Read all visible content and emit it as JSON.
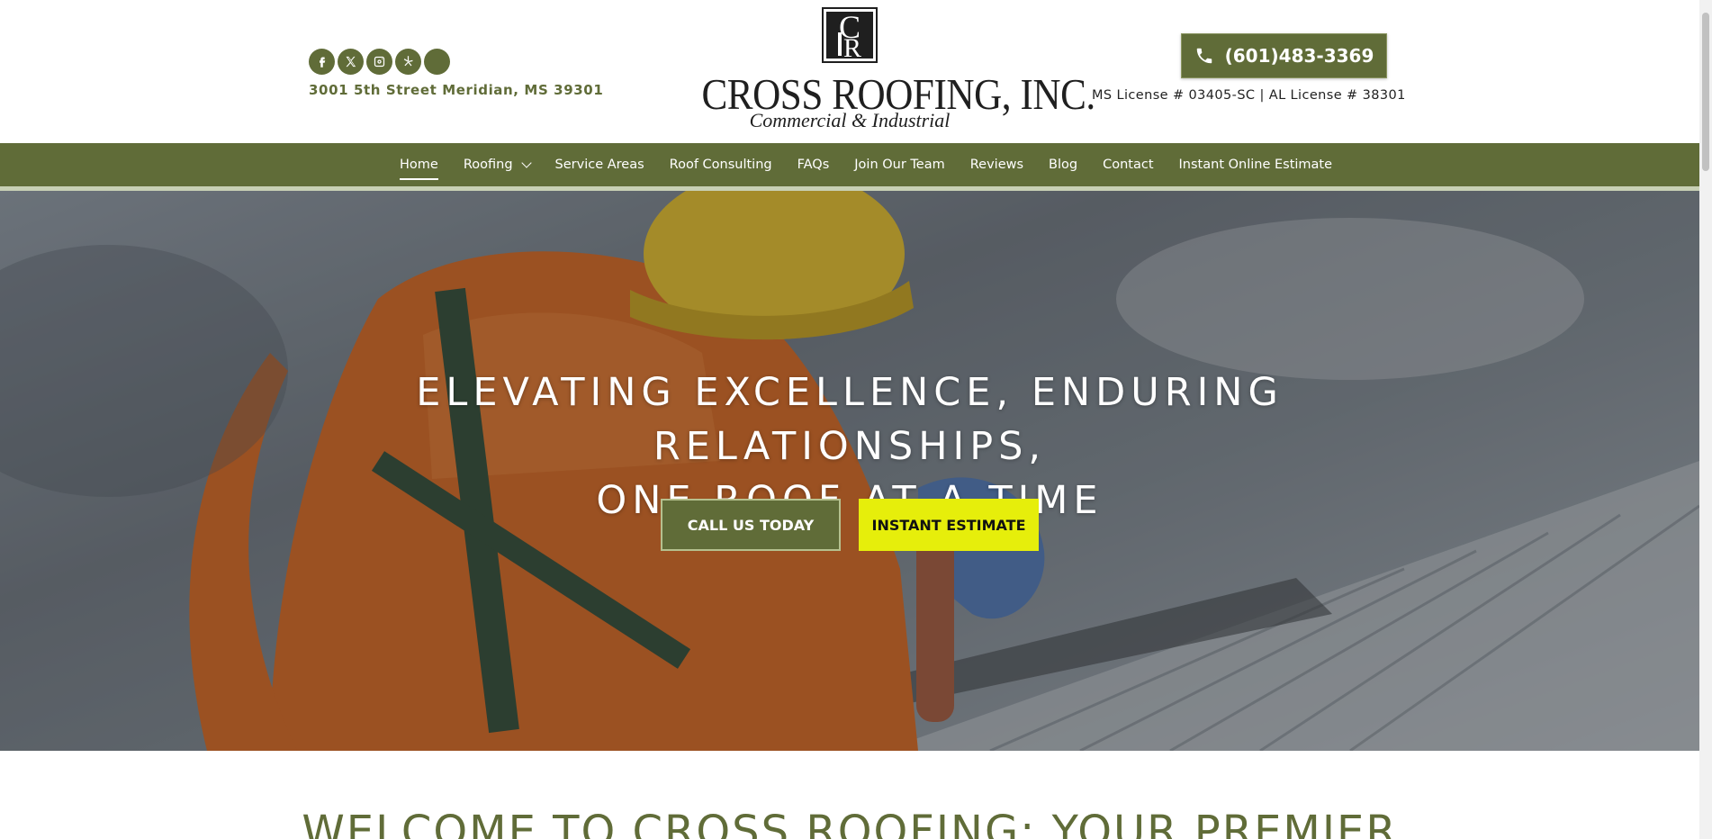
{
  "header": {
    "socials": [
      {
        "icon": "facebook-icon",
        "glyph": "f"
      },
      {
        "icon": "x-twitter-icon",
        "glyph": "𝕏"
      },
      {
        "icon": "instagram-icon",
        "glyph": ""
      },
      {
        "icon": "yelp-icon",
        "glyph": "✲"
      },
      {
        "icon": "blank-social-icon",
        "glyph": ""
      }
    ],
    "address": "3001 5th Street Meridian, MS 39301",
    "logo": {
      "name": "CROSS ROOFING, INC.",
      "tagline": "Commercial & Industrial"
    },
    "phone": "(601)483-3369",
    "license": "MS License # 03405-SC | AL License # 38301"
  },
  "nav": {
    "items": [
      {
        "label": "Home",
        "active": true
      },
      {
        "label": "Roofing",
        "has_dropdown": true
      },
      {
        "label": "Service Areas"
      },
      {
        "label": "Roof Consulting"
      },
      {
        "label": "FAQs"
      },
      {
        "label": "Join Our Team"
      },
      {
        "label": "Reviews"
      },
      {
        "label": "Blog"
      },
      {
        "label": "Contact"
      },
      {
        "label": "Instant Online Estimate"
      }
    ]
  },
  "hero": {
    "title_line1": "ELEVATING EXCELLENCE, ENDURING RELATIONSHIPS,",
    "title_line2": "ONE ROOF AT A TIME",
    "call_button": "CALL US TODAY",
    "estimate_button": "INSTANT ESTIMATE"
  },
  "welcome": {
    "heading": "WELCOME TO CROSS ROOFING: YOUR PREMIER"
  },
  "colors": {
    "brand_green": "#606c38",
    "accent_yellow": "#e6ee0b"
  }
}
